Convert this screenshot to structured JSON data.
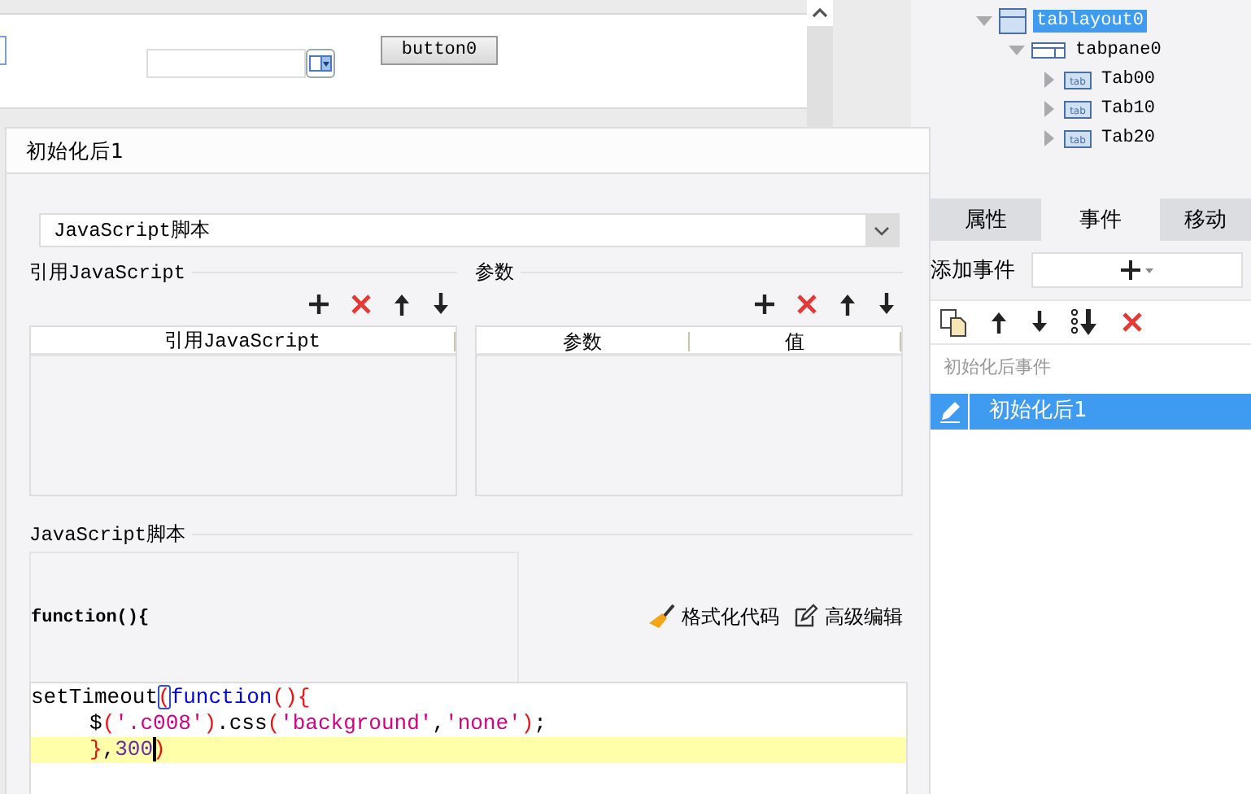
{
  "canvas": {
    "button": "button0"
  },
  "tree": [
    {
      "label": "tablayout0",
      "kind": "layout",
      "selected": true,
      "expanded": true,
      "children": [
        {
          "label": "tabpane0",
          "kind": "pane",
          "selected": false,
          "expanded": true,
          "children": [
            {
              "label": "Tab00",
              "kind": "tab",
              "selected": false,
              "expanded": false
            },
            {
              "label": "Tab10",
              "kind": "tab",
              "selected": false,
              "expanded": false
            },
            {
              "label": "Tab20",
              "kind": "tab",
              "selected": false,
              "expanded": false
            }
          ]
        }
      ]
    }
  ],
  "panel": {
    "tabs": [
      {
        "label": "属性",
        "selected": false
      },
      {
        "label": "事件",
        "selected": true
      },
      {
        "label": "移动",
        "selected": false
      }
    ],
    "add_event_label": "添加事件",
    "events_heading": "初始化后事件",
    "events": [
      {
        "label": "初始化后1",
        "selected": true
      }
    ]
  },
  "dialog": {
    "title": "初始化后1",
    "script_type": "JavaScript脚本",
    "references": {
      "title": "引用JavaScript",
      "columns": [
        "引用JavaScript"
      ]
    },
    "parameters": {
      "title": "参数",
      "columns": [
        "参数",
        "值"
      ]
    },
    "script": {
      "title": "JavaScript脚本",
      "header": "function(){",
      "actions": [
        {
          "label": "格式化代码",
          "kind": "format"
        },
        {
          "label": "高级编辑",
          "kind": "edit"
        }
      ],
      "lines": [
        {
          "current": false,
          "tokens": [
            {
              "kind": "plain",
              "text": "setTimeout"
            },
            {
              "kind": "bracket",
              "text": "(",
              "matched": true
            },
            {
              "kind": "keyword",
              "text": "function"
            },
            {
              "kind": "bracket",
              "text": "(){"
            }
          ]
        },
        {
          "current": false,
          "indent": true,
          "tokens": [
            {
              "kind": "plain",
              "text": "$"
            },
            {
              "kind": "bracket",
              "text": "("
            },
            {
              "kind": "string",
              "text": "'.c008'"
            },
            {
              "kind": "bracket",
              "text": ")"
            },
            {
              "kind": "plain",
              "text": ".css"
            },
            {
              "kind": "bracket",
              "text": "("
            },
            {
              "kind": "string",
              "text": "'background'"
            },
            {
              "kind": "plain",
              "text": ","
            },
            {
              "kind": "string",
              "text": "'none'"
            },
            {
              "kind": "bracket",
              "text": ")"
            },
            {
              "kind": "plain",
              "text": ";"
            }
          ]
        },
        {
          "current": true,
          "indent": true,
          "tokens": [
            {
              "kind": "bracket",
              "text": "}"
            },
            {
              "kind": "plain",
              "text": ","
            },
            {
              "kind": "number",
              "text": "300"
            },
            {
              "kind": "bracket",
              "text": ")",
              "cursor": true
            }
          ]
        }
      ]
    }
  }
}
